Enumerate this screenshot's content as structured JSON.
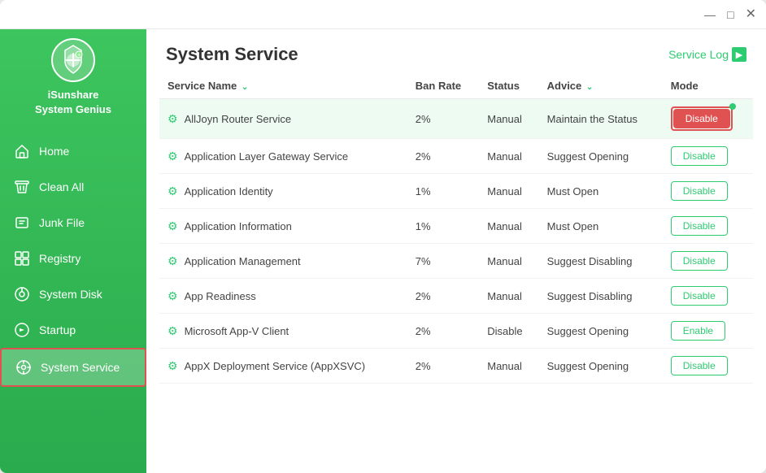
{
  "window": {
    "title": "iSunshare System Genius"
  },
  "titlebar": {
    "minimize": "—",
    "restore": "□",
    "close": "✕"
  },
  "sidebar": {
    "app_name_line1": "iSunshare",
    "app_name_line2": "System Genius",
    "items": [
      {
        "id": "home",
        "label": "Home",
        "icon": "home-icon",
        "active": false
      },
      {
        "id": "clean-all",
        "label": "Clean All",
        "icon": "clean-icon",
        "active": false
      },
      {
        "id": "junk-file",
        "label": "Junk File",
        "icon": "junk-icon",
        "active": false
      },
      {
        "id": "registry",
        "label": "Registry",
        "icon": "registry-icon",
        "active": false
      },
      {
        "id": "system-disk",
        "label": "System Disk",
        "icon": "disk-icon",
        "active": false
      },
      {
        "id": "startup",
        "label": "Startup",
        "icon": "startup-icon",
        "active": false
      },
      {
        "id": "system-service",
        "label": "System Service",
        "icon": "service-icon",
        "active": true
      }
    ]
  },
  "content": {
    "title": "System Service",
    "service_log_label": "Service Log",
    "table": {
      "columns": [
        {
          "id": "name",
          "label": "Service Name",
          "sortable": true
        },
        {
          "id": "ban_rate",
          "label": "Ban Rate",
          "sortable": false
        },
        {
          "id": "status",
          "label": "Status",
          "sortable": false
        },
        {
          "id": "advice",
          "label": "Advice",
          "sortable": true
        },
        {
          "id": "mode",
          "label": "Mode",
          "sortable": false
        }
      ],
      "rows": [
        {
          "name": "AllJoyn Router Service",
          "ban_rate": "2%",
          "status": "Manual",
          "advice": "Maintain the Status",
          "action": "Disable",
          "highlighted": true
        },
        {
          "name": "Application Layer Gateway Service",
          "ban_rate": "2%",
          "status": "Manual",
          "advice": "Suggest Opening",
          "action": "Disable",
          "highlighted": false
        },
        {
          "name": "Application Identity",
          "ban_rate": "1%",
          "status": "Manual",
          "advice": "Must Open",
          "action": "Disable",
          "highlighted": false
        },
        {
          "name": "Application Information",
          "ban_rate": "1%",
          "status": "Manual",
          "advice": "Must Open",
          "action": "Disable",
          "highlighted": false
        },
        {
          "name": "Application Management",
          "ban_rate": "7%",
          "status": "Manual",
          "advice": "Suggest Disabling",
          "action": "Disable",
          "highlighted": false
        },
        {
          "name": "App Readiness",
          "ban_rate": "2%",
          "status": "Manual",
          "advice": "Suggest Disabling",
          "action": "Disable",
          "highlighted": false
        },
        {
          "name": "Microsoft App-V Client",
          "ban_rate": "2%",
          "status": "Disable",
          "advice": "Suggest Opening",
          "action": "Enable",
          "highlighted": false
        },
        {
          "name": "AppX Deployment Service (AppXSVC)",
          "ban_rate": "2%",
          "status": "Manual",
          "advice": "Suggest Opening",
          "action": "Disable",
          "highlighted": false
        }
      ]
    }
  }
}
